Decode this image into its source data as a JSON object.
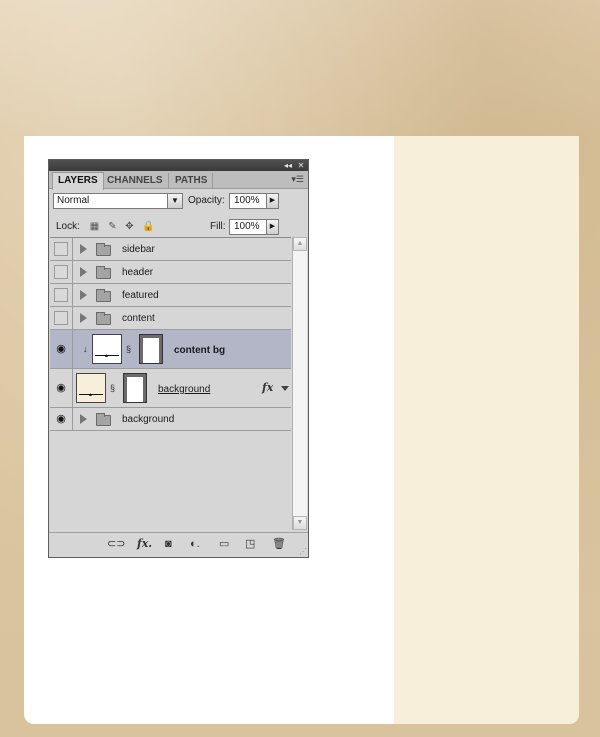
{
  "panel": {
    "tabs": [
      "LAYERS",
      "CHANNELS",
      "PATHS"
    ],
    "blend_mode": "Normal",
    "opacity_label": "Opacity:",
    "opacity_value": "100%",
    "lock_label": "Lock:",
    "fill_label": "Fill:",
    "fill_value": "100%"
  },
  "layers": [
    {
      "name": "sidebar",
      "type": "group",
      "visible": false
    },
    {
      "name": "header",
      "type": "group",
      "visible": false
    },
    {
      "name": "featured",
      "type": "group",
      "visible": false
    },
    {
      "name": "content",
      "type": "group",
      "visible": false
    },
    {
      "name": "content bg",
      "type": "layer",
      "visible": true,
      "selected": true
    },
    {
      "name": "background",
      "type": "layer",
      "visible": true,
      "fx": "fx"
    },
    {
      "name": "background",
      "type": "group",
      "visible": true
    }
  ],
  "colors": {
    "selected_row": "#b3b6c6",
    "sidebar_bg": "#f7efd9",
    "background_thumb": "#f7efd9"
  }
}
